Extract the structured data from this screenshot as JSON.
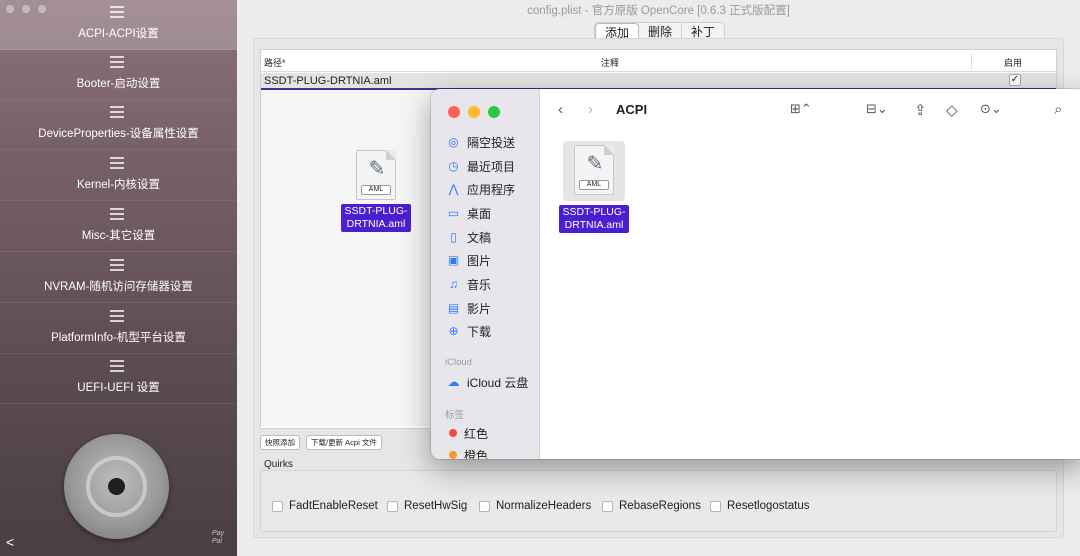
{
  "window_title": "config.plist - 官方原版 OpenCore [0.6.3 正式版配置]",
  "sidebar": {
    "items": [
      {
        "label": "ACPI-ACPI设置",
        "active": true
      },
      {
        "label": "Booter-启动设置"
      },
      {
        "label": "DeviceProperties-设备属性设置"
      },
      {
        "label": "Kernel-内核设置"
      },
      {
        "label": "Misc-其它设置"
      },
      {
        "label": "NVRAM-随机访问存储器设置"
      },
      {
        "label": "PlatformInfo-机型平台设置"
      },
      {
        "label": "UEFI-UEFI 设置"
      }
    ],
    "paypal_line1": "Pay",
    "paypal_line2": "Pal"
  },
  "segmented": {
    "tabs": [
      "添加",
      "删除",
      "补丁"
    ],
    "active": 0
  },
  "table": {
    "columns": {
      "path": "路径*",
      "comment": "注释",
      "enabled": "启用"
    },
    "rows": [
      {
        "path": "SSDT-PLUG-DRTNIA.aml",
        "enabled_mark": "✓"
      }
    ]
  },
  "dragged_file": {
    "badge": "AML",
    "name_line1": "SSDT-PLUG-",
    "name_line2": "DRTNIA.aml"
  },
  "mini_buttons": [
    "快照添加",
    "下载/更新 Acpi 文件"
  ],
  "quirks": {
    "label": "Quirks",
    "items": [
      "FadtEnableReset",
      "ResetHwSig",
      "NormalizeHeaders",
      "RebaseRegions",
      "Resetlogostatus"
    ]
  },
  "finder": {
    "title": "ACPI",
    "favorites": [
      {
        "icon": "airdrop-icon",
        "glyph": "◎",
        "label": "隔空投送"
      },
      {
        "icon": "recents-icon",
        "glyph": "◷",
        "label": "最近项目"
      },
      {
        "icon": "applications-icon",
        "glyph": "⋀",
        "label": "应用程序"
      },
      {
        "icon": "desktop-icon",
        "glyph": "▭",
        "label": "桌面"
      },
      {
        "icon": "documents-icon",
        "glyph": "▯",
        "label": "文稿"
      },
      {
        "icon": "pictures-icon",
        "glyph": "▣",
        "label": "图片"
      },
      {
        "icon": "music-icon",
        "glyph": "♫",
        "label": "音乐"
      },
      {
        "icon": "movies-icon",
        "glyph": "▤",
        "label": "影片"
      },
      {
        "icon": "downloads-icon",
        "glyph": "⊕",
        "label": "下载"
      }
    ],
    "icloud_section": "iCloud",
    "icloud_drive": "iCloud 云盘",
    "tags_section": "标签",
    "tags": [
      {
        "label": "红色",
        "color": "#f04a3e"
      },
      {
        "label": "橙色",
        "color": "#f39a2b"
      }
    ],
    "file": {
      "badge": "AML",
      "name_line1": "SSDT-PLUG-",
      "name_line2": "DRTNIA.aml"
    }
  },
  "colors": {
    "selection": "#4b1fd0",
    "accent": "#2f7cf6"
  }
}
